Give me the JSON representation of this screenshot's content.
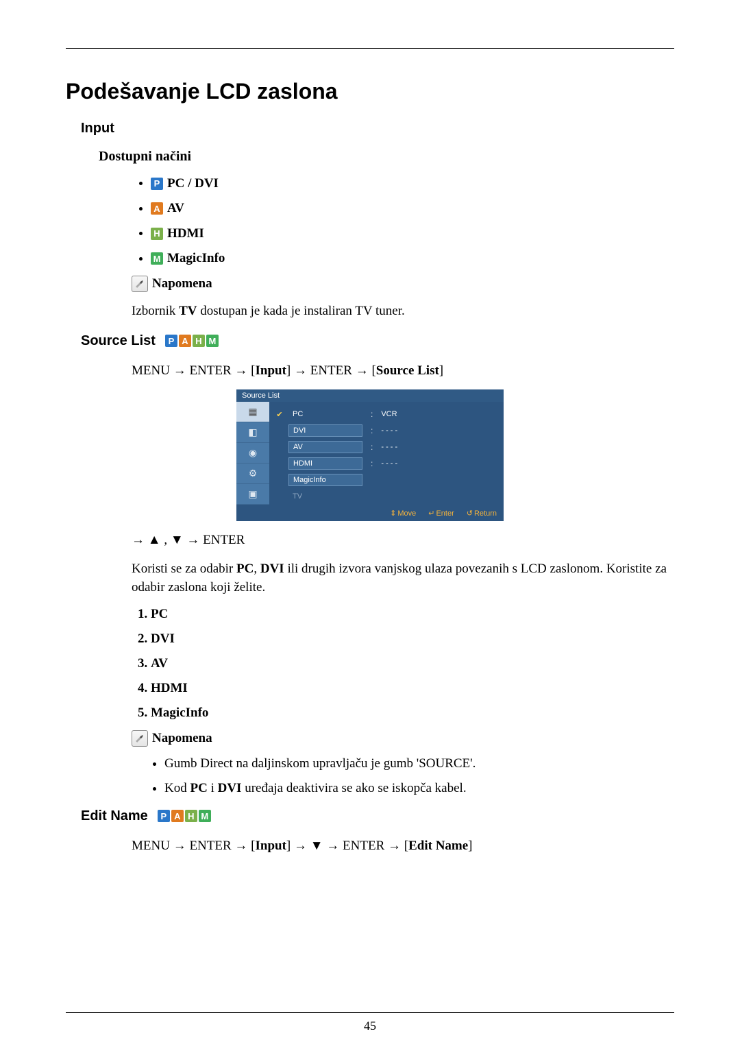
{
  "page_number": "45",
  "title": "Podešavanje LCD zaslona",
  "section_input": {
    "heading": "Input",
    "modes_heading": "Dostupni načini",
    "modes": [
      {
        "icon": "P",
        "label": "PC / DVI"
      },
      {
        "icon": "A",
        "label": "AV"
      },
      {
        "icon": "H",
        "label": "HDMI"
      },
      {
        "icon": "M",
        "label": "MagicInfo"
      }
    ],
    "note_label": "Napomena",
    "note_text_prefix": "Izbornik ",
    "note_text_bold": "TV",
    "note_text_suffix": " dostupan je kada je instaliran TV tuner."
  },
  "section_source": {
    "heading": "Source List",
    "menu_path_parts": [
      "MENU → ENTER → [",
      "Input",
      "] → ENTER → [",
      "Source List",
      "]"
    ],
    "osd": {
      "title": "Source List",
      "side_icons": [
        "▦",
        "◧",
        "◉",
        "⚙",
        "▣"
      ],
      "rows": [
        {
          "label": "PC",
          "checked": true,
          "value": "VCR",
          "boxed": false
        },
        {
          "label": "DVI",
          "checked": false,
          "value": "- - - -",
          "boxed": true
        },
        {
          "label": "AV",
          "checked": false,
          "value": "- - - -",
          "boxed": true
        },
        {
          "label": "HDMI",
          "checked": false,
          "value": "- - - -",
          "boxed": true
        },
        {
          "label": "MagicInfo",
          "checked": false,
          "value": "",
          "boxed": true
        },
        {
          "label": "TV",
          "checked": false,
          "value": "",
          "boxed": false,
          "dim": true
        }
      ],
      "footer": {
        "move": "Move",
        "enter": "Enter",
        "return": "Return"
      }
    },
    "nav_hint_prefix": "→ ",
    "nav_hint_middle": " , ",
    "nav_hint_suffix": " → ENTER",
    "description_parts": [
      "Koristi se za odabir ",
      "PC",
      ", ",
      "DVI",
      " ili drugih izvora vanjskog ulaza povezanih s LCD zaslonom. Koristite za odabir zaslona koji želite."
    ],
    "source_list": [
      "PC",
      "DVI",
      "AV",
      "HDMI",
      "MagicInfo"
    ],
    "note_label": "Napomena",
    "notes": [
      "Gumb Direct na daljinskom upravljaču je gumb 'SOURCE'.",
      {
        "parts": [
          "Kod  ",
          "PC",
          " i ",
          "DVI",
          " uređaja deaktivira se ako se iskopča kabel."
        ]
      }
    ]
  },
  "section_edit": {
    "heading": "Edit Name",
    "menu_path_parts": [
      "MENU → ENTER → [",
      "Input",
      "] → ",
      "▼",
      " → ENTER → [",
      "Edit Name",
      "]"
    ]
  }
}
